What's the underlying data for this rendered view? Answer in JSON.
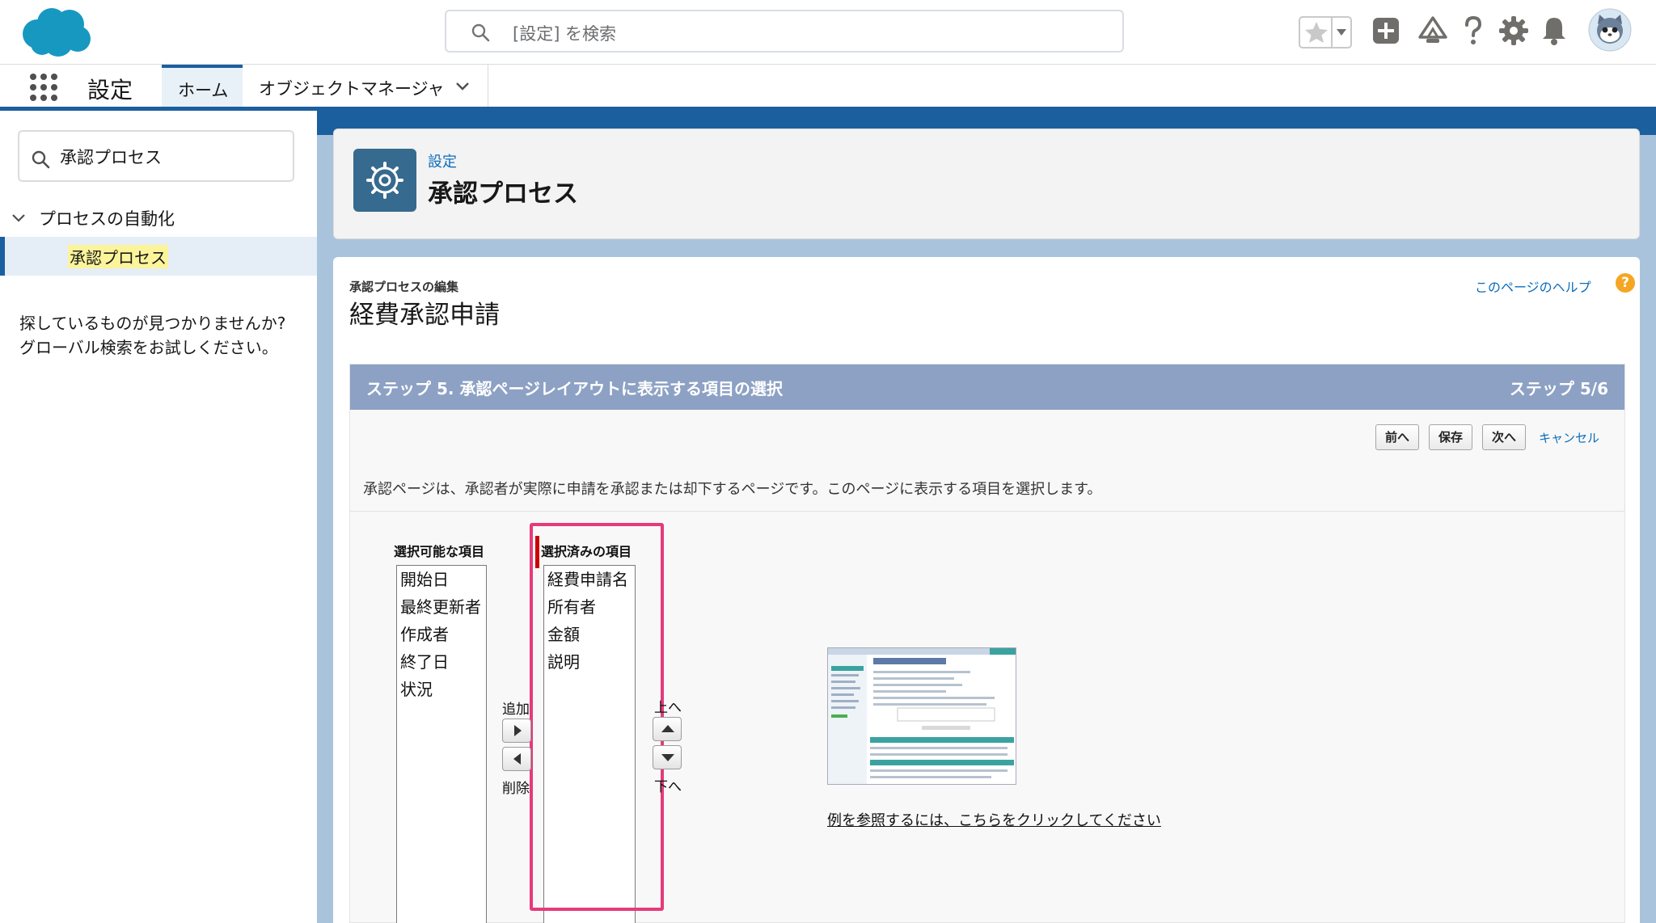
{
  "header": {
    "search_placeholder": "[設定] を検索"
  },
  "nav": {
    "app_name": "設定",
    "tabs": [
      {
        "label": "ホーム"
      },
      {
        "label": "オブジェクトマネージャ"
      }
    ]
  },
  "sidebar": {
    "search_value": "承認プロセス",
    "group_label": "プロセスの自動化",
    "active_item": "承認プロセス",
    "help_line1": "探しているものが見つかりませんか?",
    "help_line2": "グローバル検索をお試しください。"
  },
  "page_header": {
    "breadcrumb": "設定",
    "title": "承認プロセス"
  },
  "content": {
    "subtitle": "承認プロセスの編集",
    "title": "経費承認申請",
    "help_link": "このページのヘルプ",
    "help_badge": "?",
    "step": {
      "title": "ステップ 5. 承認ページレイアウトに表示する項目の選択",
      "counter": "ステップ 5/6"
    },
    "buttons": {
      "prev": "前へ",
      "save": "保存",
      "next": "次へ",
      "cancel": "キャンセル"
    },
    "description": "承認ページは、承認者が実際に申請を承認または却下するページです。このページに表示する項目を選択します。",
    "available_label": "選択可能な項目",
    "selected_label": "選択済みの項目",
    "available_items": [
      "開始日",
      "最終更新者",
      "作成者",
      "終了日",
      "状況"
    ],
    "selected_items": [
      "経費申請名",
      "所有者",
      "金額",
      "説明"
    ],
    "add_label": "追加",
    "remove_label": "削除",
    "up_label": "上へ",
    "down_label": "下へ",
    "example_link": "例を参照するには、こちらをクリックしてください"
  },
  "colors": {
    "brand_blue": "#1b5f9e",
    "link_blue": "#0b6dbd",
    "step_header": "#8da1c4",
    "highlight_pink": "#e63a7a",
    "page_icon": "#366a8e"
  },
  "icons": [
    "salesforce-cloud-logo",
    "search-icon",
    "star-icon",
    "add-icon",
    "trailhead-icon",
    "help-icon",
    "gear-icon",
    "bell-icon",
    "avatar",
    "app-launcher-icon",
    "chevron-down-icon"
  ]
}
